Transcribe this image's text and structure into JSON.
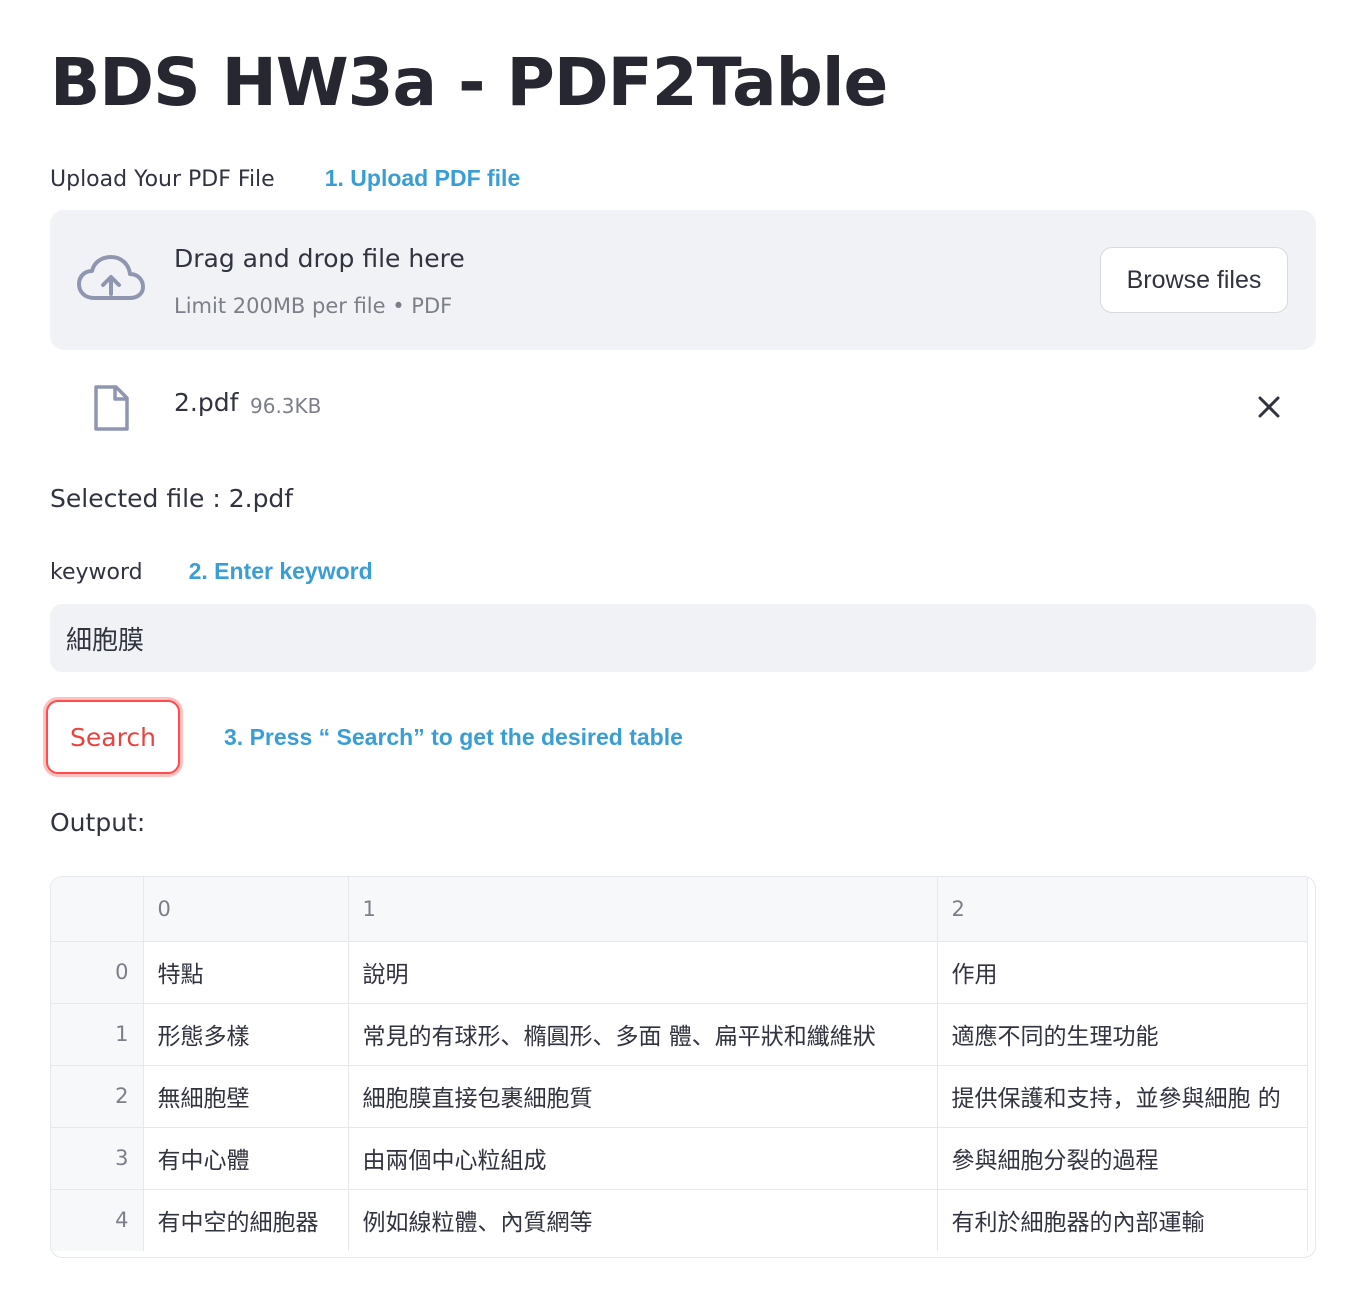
{
  "page": {
    "title": "BDS HW3a - PDF2Table"
  },
  "upload": {
    "label": "Upload Your PDF File",
    "annotation": "1. Upload PDF file",
    "drag_text": "Drag and drop file here",
    "limit_text": "Limit 200MB per file • PDF",
    "browse_label": "Browse files"
  },
  "file": {
    "name": "2.pdf",
    "size": "96.3KB"
  },
  "selected_text": "Selected file : 2.pdf",
  "keyword": {
    "label": "keyword",
    "annotation": "2. Enter keyword",
    "value": "細胞膜"
  },
  "search": {
    "label": "Search",
    "annotation": "3. Press “ Search” to get the desired table"
  },
  "output": {
    "label": "Output:",
    "columns": [
      "0",
      "1",
      "2"
    ],
    "rows": [
      {
        "index": "0",
        "cells": [
          "特點",
          "說明",
          "作用"
        ]
      },
      {
        "index": "1",
        "cells": [
          "形態多樣",
          "常見的有球形、橢圓形、多面 體、扁平狀和纖維狀",
          "適應不同的生理功能"
        ]
      },
      {
        "index": "2",
        "cells": [
          "無細胞壁",
          "細胞膜直接包裹細胞質",
          "提供保護和支持，並參與細胞 的"
        ]
      },
      {
        "index": "3",
        "cells": [
          "有中心體",
          "由兩個中心粒組成",
          "參與細胞分裂的過程"
        ]
      },
      {
        "index": "4",
        "cells": [
          "有中空的細胞器",
          "例如線粒體、內質網等",
          "有利於細胞器的內部運輸"
        ]
      }
    ]
  },
  "colors": {
    "accent": "#ff4b4b",
    "annotation": "#3a9ed6",
    "panel": "#f0f2f6"
  },
  "icons": {
    "upload": "cloud-upload-icon",
    "file": "file-icon",
    "close": "close-icon"
  }
}
